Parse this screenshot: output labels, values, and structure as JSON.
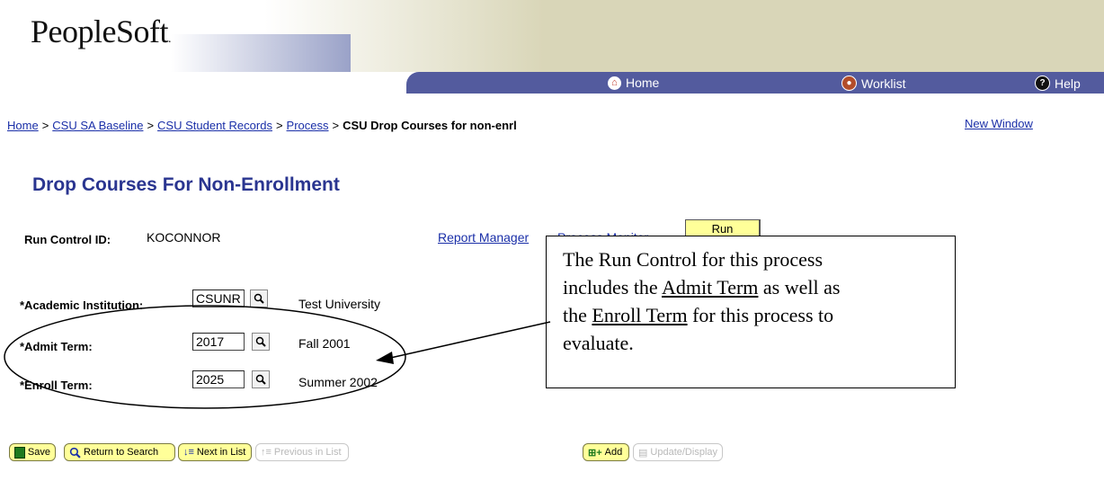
{
  "header": {
    "logo_text": "PeopleSoft",
    "logo_mark": ".",
    "nav": {
      "home": "Home",
      "worklist": "Worklist",
      "help": "Help"
    }
  },
  "breadcrumb": {
    "items": [
      "Home",
      "CSU SA Baseline",
      "CSU Student Records",
      "Process"
    ],
    "separator": ">",
    "current": "CSU Drop Courses for non-enrl",
    "new_window": "New Window"
  },
  "page": {
    "title": "Drop Courses For Non-Enrollment",
    "run_control_label": "Run Control ID:",
    "run_control_value": "KOCONNOR",
    "report_manager": "Report Manager",
    "process_monitor": "Process Monitor",
    "run_label": "Run"
  },
  "form": {
    "institution_label": "*Academic Institution:",
    "institution_value": "CSUNR",
    "institution_desc": "Test University",
    "admit_label": "*Admit Term:",
    "admit_value": "2017",
    "admit_desc": "Fall 2001",
    "enroll_label": "*Enroll Term:",
    "enroll_value": "2025",
    "enroll_desc": "Summer 2002"
  },
  "callout": {
    "line1": "The Run Control for this process",
    "line2_pre": "includes the ",
    "line2_u": "Admit Term",
    "line2_post": " as well as",
    "line3_pre": "the ",
    "line3_u": "Enroll Term",
    "line3_post": " for this process to",
    "line4": "evaluate."
  },
  "toolbar": {
    "save": "Save",
    "return_to_search": "Return to Search",
    "next_in_list": "Next in List",
    "previous_in_list": "Previous in List",
    "add": "Add",
    "update_display": "Update/Display"
  }
}
